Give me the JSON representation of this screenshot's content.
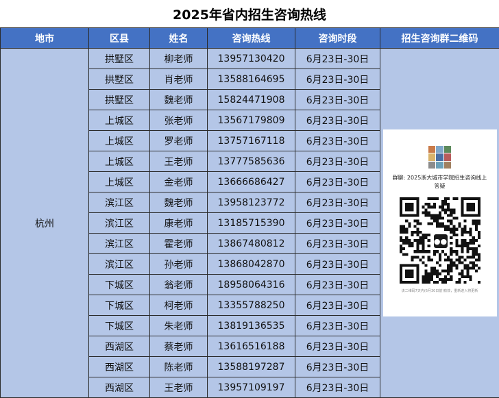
{
  "title": "2025年省内招生咨询热线",
  "headers": [
    "地市",
    "区县",
    "姓名",
    "咨询热线",
    "咨询时段",
    "招生咨询群二维码"
  ],
  "city": "杭州",
  "rows": [
    {
      "district": "拱墅区",
      "name": "柳老师",
      "phone": "13957130420",
      "period": "6月23日-30日"
    },
    {
      "district": "拱墅区",
      "name": "肖老师",
      "phone": "13588164695",
      "period": "6月23日-30日"
    },
    {
      "district": "拱墅区",
      "name": "魏老师",
      "phone": "15824471908",
      "period": "6月23日-30日"
    },
    {
      "district": "上城区",
      "name": "张老师",
      "phone": "13567179809",
      "period": "6月23日-30日"
    },
    {
      "district": "上城区",
      "name": "罗老师",
      "phone": "13757167118",
      "period": "6月23日-30日"
    },
    {
      "district": "上城区",
      "name": "王老师",
      "phone": "13777585636",
      "period": "6月23日-30日"
    },
    {
      "district": "上城区",
      "name": "金老师",
      "phone": "13666686427",
      "period": "6月23日-30日"
    },
    {
      "district": "滨江区",
      "name": "魏老师",
      "phone": "13958123772",
      "period": "6月23日-30日"
    },
    {
      "district": "滨江区",
      "name": "康老师",
      "phone": "13185715390",
      "period": "6月23日-30日"
    },
    {
      "district": "滨江区",
      "name": "霍老师",
      "phone": "13867480812",
      "period": "6月23日-30日"
    },
    {
      "district": "滨江区",
      "name": "孙老师",
      "phone": "13868042870",
      "period": "6月23日-30日"
    },
    {
      "district": "下城区",
      "name": "翁老师",
      "phone": "18958064316",
      "period": "6月23日-30日"
    },
    {
      "district": "下城区",
      "name": "柯老师",
      "phone": "13355788250",
      "period": "6月23日-30日"
    },
    {
      "district": "下城区",
      "name": "朱老师",
      "phone": "13819136535",
      "period": "6月23日-30日"
    },
    {
      "district": "西湖区",
      "name": "蔡老师",
      "phone": "13616516188",
      "period": "6月23日-30日"
    },
    {
      "district": "西湖区",
      "name": "陈老师",
      "phone": "13588197287",
      "period": "6月23日-30日"
    },
    {
      "district": "西湖区",
      "name": "王老师",
      "phone": "13957109197",
      "period": "6月23日-30日"
    }
  ],
  "qr": {
    "group_name": "群聊: 2025浙大城市学院招生咨询线上答疑",
    "note": "该二维码7天内(6月30日前)有效，重新进入将更新",
    "center_icon": "wechat-icon",
    "avatar_colors": [
      "#c97b4a",
      "#7fa7c9",
      "#5d8a5c",
      "#d9b36b",
      "#4a6fa5",
      "#b85c5c",
      "#8c8c8c",
      "#6aa0b8",
      "#a08060"
    ]
  }
}
